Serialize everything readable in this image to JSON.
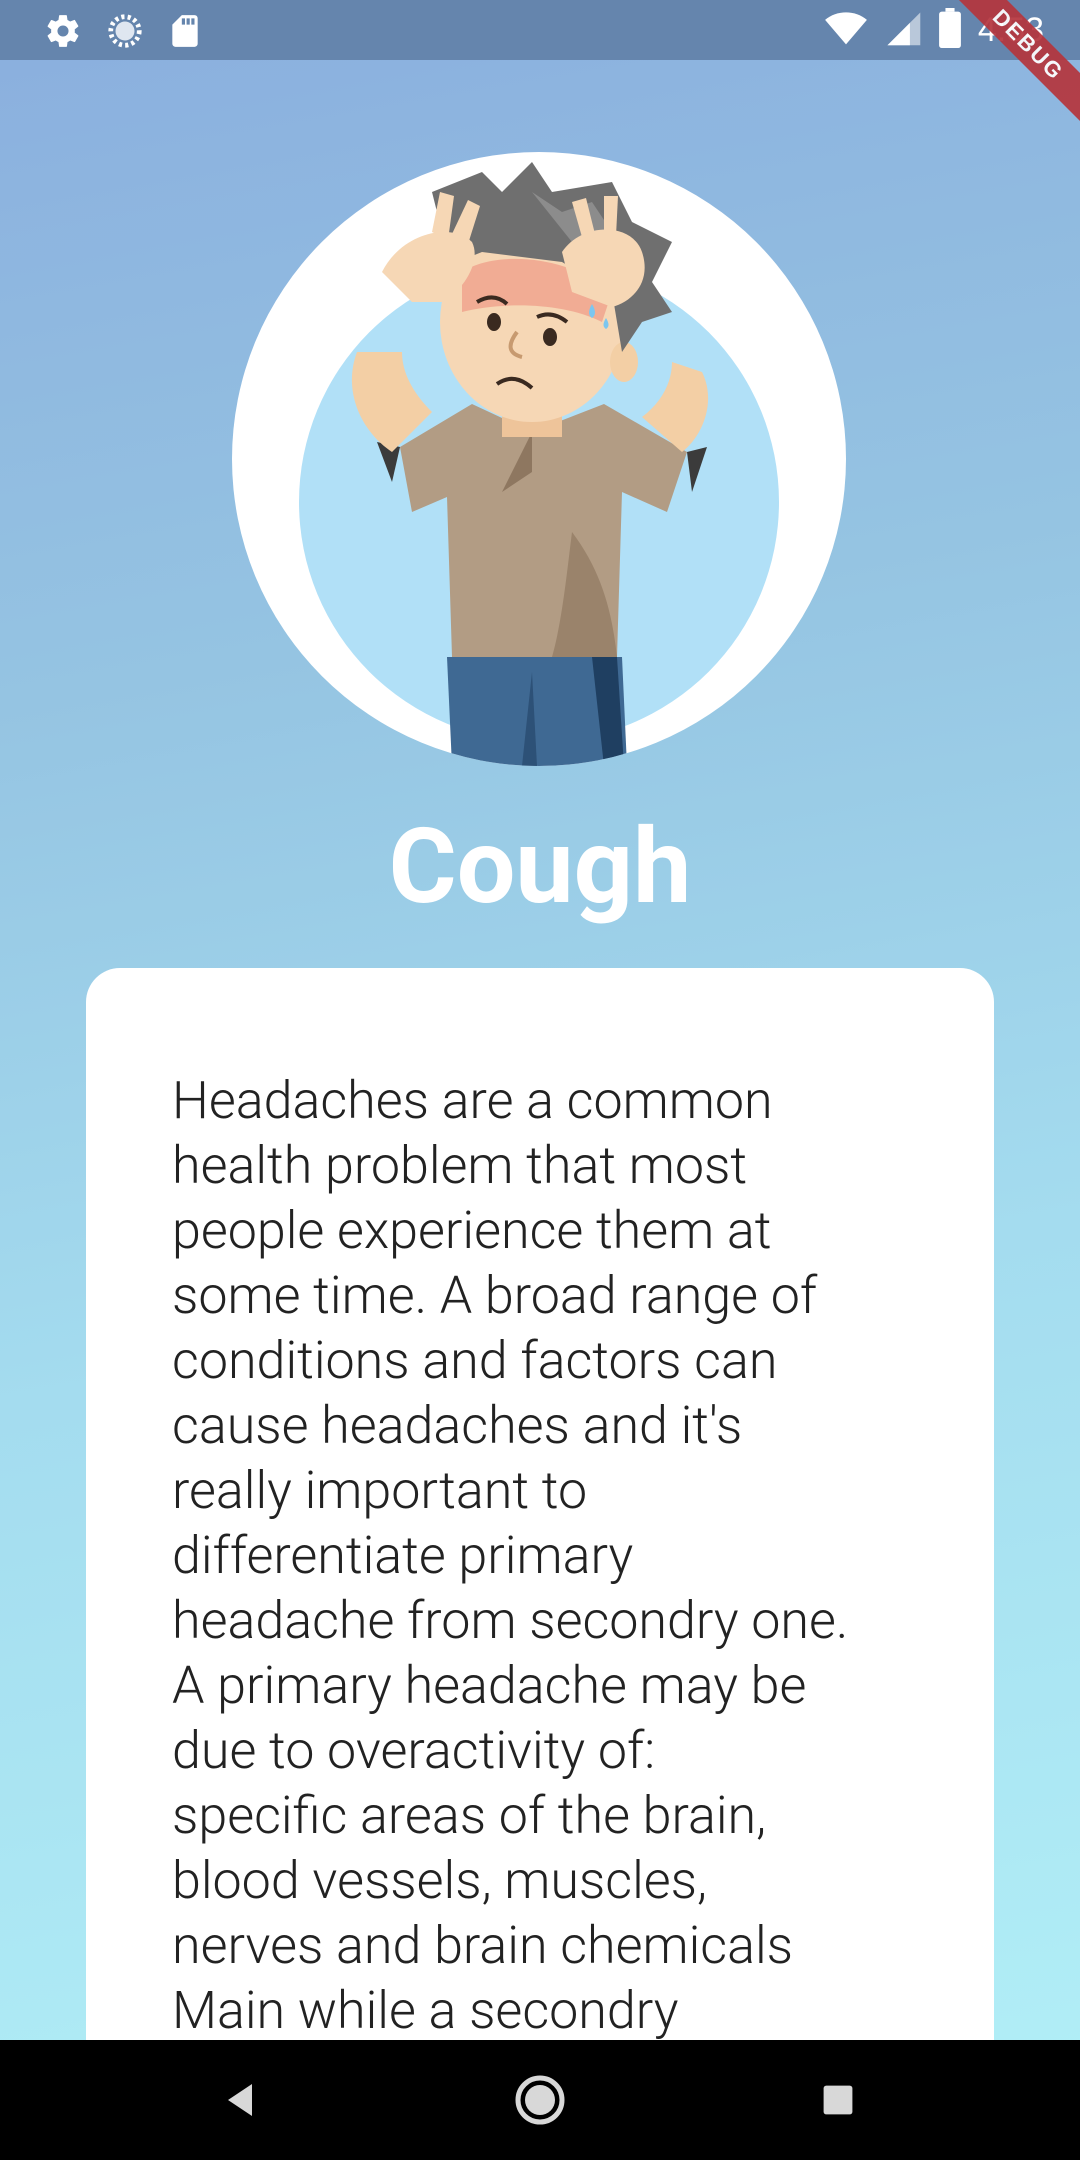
{
  "status_bar": {
    "time": "4:53",
    "left_icons": [
      "settings-icon",
      "sync-icon",
      "sd-card-icon"
    ],
    "right_icons": [
      "wifi-icon",
      "signal-icon",
      "battery-icon"
    ],
    "debug_label": "DEBUG",
    "background": "#6585ad"
  },
  "header": {
    "title": "Cough"
  },
  "illustration": {
    "icon": "headache-person-illustration"
  },
  "card": {
    "text": "Headaches are a common\nhealth problem that most\npeople experience them at\nsome time. A broad range of\nconditions and factors can\ncause headaches and it's\nreally important to\ndifferentiate primary\nheadache from secondry one.\nA primary headache may be\ndue to overactivity of:\nspecific areas of the brain,\nblood vessels, muscles,\nnerves and brain chemicals\nMain while a secondry"
  },
  "nav_bar": {
    "buttons": [
      "back-button",
      "home-button",
      "recents-button"
    ]
  },
  "colors": {
    "gradient_top": "#8aaede",
    "gradient_bottom": "#b2f0f7",
    "title": "#ffffff",
    "card_bg": "#ffffff",
    "text": "#222222"
  }
}
